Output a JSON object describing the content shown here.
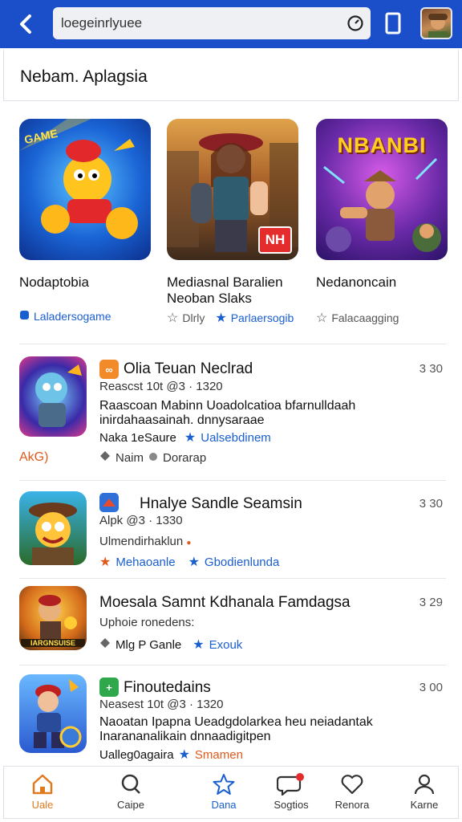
{
  "header": {
    "search_text": "loegeinrlyuee",
    "back_icon": "back-arrow-icon",
    "colors": {
      "bar": "#1b4fc9"
    }
  },
  "section": {
    "title": "Nebam. Aplagsia"
  },
  "featured": [
    {
      "art_label": "GAME",
      "name": "Nodaptobia",
      "tag_icon": "tag-icon",
      "tag": "Laladersogame"
    },
    {
      "art_label": "NH",
      "name": "Mediasnal Baralien Neoban Slaks",
      "tag1": "Dlrly",
      "tag2": "Parlaersogib"
    },
    {
      "art_label": "NBANBI",
      "name": "Nedanoncain",
      "tag": "Falacaagging"
    }
  ],
  "list": [
    {
      "title": "Olia Teuan Neclrad",
      "meta": "Reascst 10t   @3 · 1320",
      "desc": "Raascoan Mabinn Uoadolcatioa bfarnulldaah inirdahaasainah. dnnysaraae",
      "tag1": "Naka 1eSaure",
      "tag2": "Ualsebdinem",
      "side_label": "AkG)",
      "tag3": "Naim",
      "tag4": "Dorarap",
      "size": "3 30"
    },
    {
      "title": "Hnalye Sandle Seamsin",
      "meta": "Alpk   @3 · 1330",
      "desc": "Ulmendirhaklun",
      "tag1": "Mehaoanle",
      "tag2": "Gbodienlunda",
      "size": "3 30"
    },
    {
      "title": "Moesala Samnt Kdhanala Famdagsa",
      "meta": "Uphoie ronedens:",
      "tag1": "Mlg P Ganle",
      "tag2": "Exouk",
      "art_label": "IARGNSUISE",
      "size": "3 29"
    },
    {
      "title": "Finoutedains",
      "meta": "Neasest 10t   @3 · 1320",
      "desc": "Naoatan Ipapna Ueadgdolarkea heu neiadantak Inarananalikain dnnaadigitpen",
      "tag1": "Ualleg0agaira",
      "tag2": "Smamen",
      "size": "3 00"
    }
  ],
  "nav": [
    {
      "label": "Uale",
      "icon": "home-icon"
    },
    {
      "label": "Caipe",
      "icon": "search-icon"
    },
    {
      "label": "Dana",
      "icon": "star-icon"
    },
    {
      "label": "Sogtios",
      "icon": "chat-icon"
    },
    {
      "label": "Renora",
      "icon": "heart-icon"
    },
    {
      "label": "Karne",
      "icon": "profile-icon"
    }
  ]
}
